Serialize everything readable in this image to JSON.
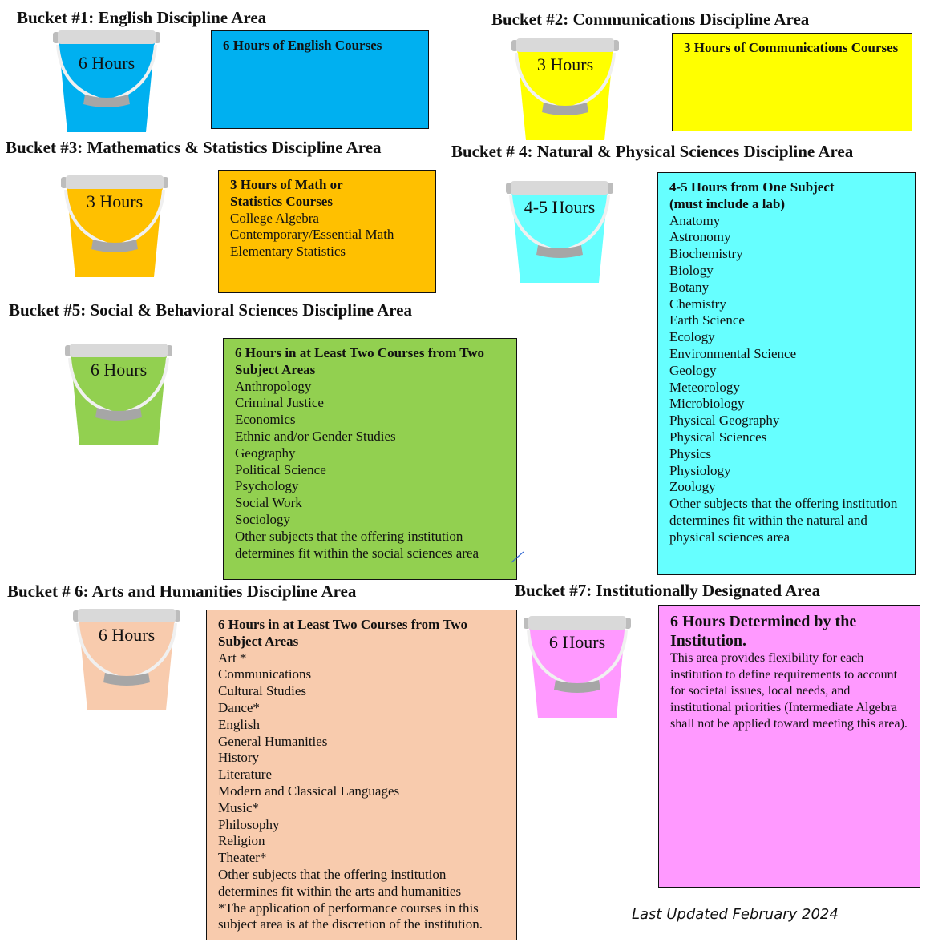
{
  "buckets": [
    {
      "heading": "Bucket #1: English Discipline Area",
      "hours": "6 Hours",
      "color": "#00B0F0",
      "box_title": "6 Hours of English Courses",
      "items": []
    },
    {
      "heading": "Bucket #2: Communications Discipline Area",
      "hours": "3 Hours",
      "color": "#FFFF00",
      "box_title": "3 Hours of Communications Courses",
      "items": []
    },
    {
      "heading": "Bucket #3: Mathematics & Statistics Discipline Area",
      "hours": "3 Hours",
      "color": "#FFC000",
      "box_title": "3 Hours of Math or Statistics Courses",
      "items": [
        "College Algebra",
        "Contemporary/Essential Math",
        "Elementary Statistics"
      ]
    },
    {
      "heading": "Bucket # 4: Natural & Physical Sciences Discipline Area",
      "hours": "4-5 Hours",
      "color": "#66FFFF",
      "box_title": "4-5 Hours from One Subject (must include a lab)",
      "items": [
        "Anatomy",
        "Astronomy",
        "Biochemistry",
        "Biology",
        "Botany",
        "Chemistry",
        "Earth Science",
        "Ecology",
        "Environmental Science",
        "Geology",
        "Meteorology",
        "Microbiology",
        "Physical Geography",
        "Physical Sciences",
        "Physics",
        "Physiology",
        "Zoology",
        "Other subjects that the offering institution determines fit within the natural and physical sciences area"
      ]
    },
    {
      "heading": "Bucket #5: Social & Behavioral Sciences Discipline Area",
      "hours": "6 Hours",
      "color": "#92D050",
      "box_title": "6 Hours in at Least Two Courses from Two Subject Areas",
      "items": [
        "Anthropology",
        "Criminal Justice",
        "Economics",
        "Ethnic and/or Gender Studies",
        "Geography",
        "Political Science",
        "Psychology",
        "Social Work",
        "Sociology",
        "Other subjects that the offering institution determines fit within the social sciences area"
      ]
    },
    {
      "heading": "Bucket # 6: Arts and Humanities Discipline Area",
      "hours": "6 Hours",
      "color": "#F8CBAD",
      "box_title": "6 Hours in at Least Two Courses from Two Subject Areas",
      "items": [
        "Art *",
        "Communications",
        "Cultural Studies",
        "Dance*",
        "English",
        "General Humanities",
        "History",
        "Literature",
        "Modern and Classical Languages",
        "Music*",
        "Philosophy",
        "Religion",
        "Theater*",
        "Other subjects that the offering institution determines fit within the arts and humanities",
        "*The application of performance courses in this subject area is at the discretion of the institution."
      ]
    },
    {
      "heading": "Bucket #7: Institutionally Designated Area",
      "hours": "6 Hours",
      "color": "#FF99FF",
      "box_title": "6 Hours Determined by the Institution.",
      "items": [
        "This area provides flexibility for each institution to define requirements to account for societal issues, local needs, and institutional priorities (Intermediate Algebra shall not be applied toward meeting this area)."
      ]
    }
  ],
  "footer": "Last Updated February 2024"
}
